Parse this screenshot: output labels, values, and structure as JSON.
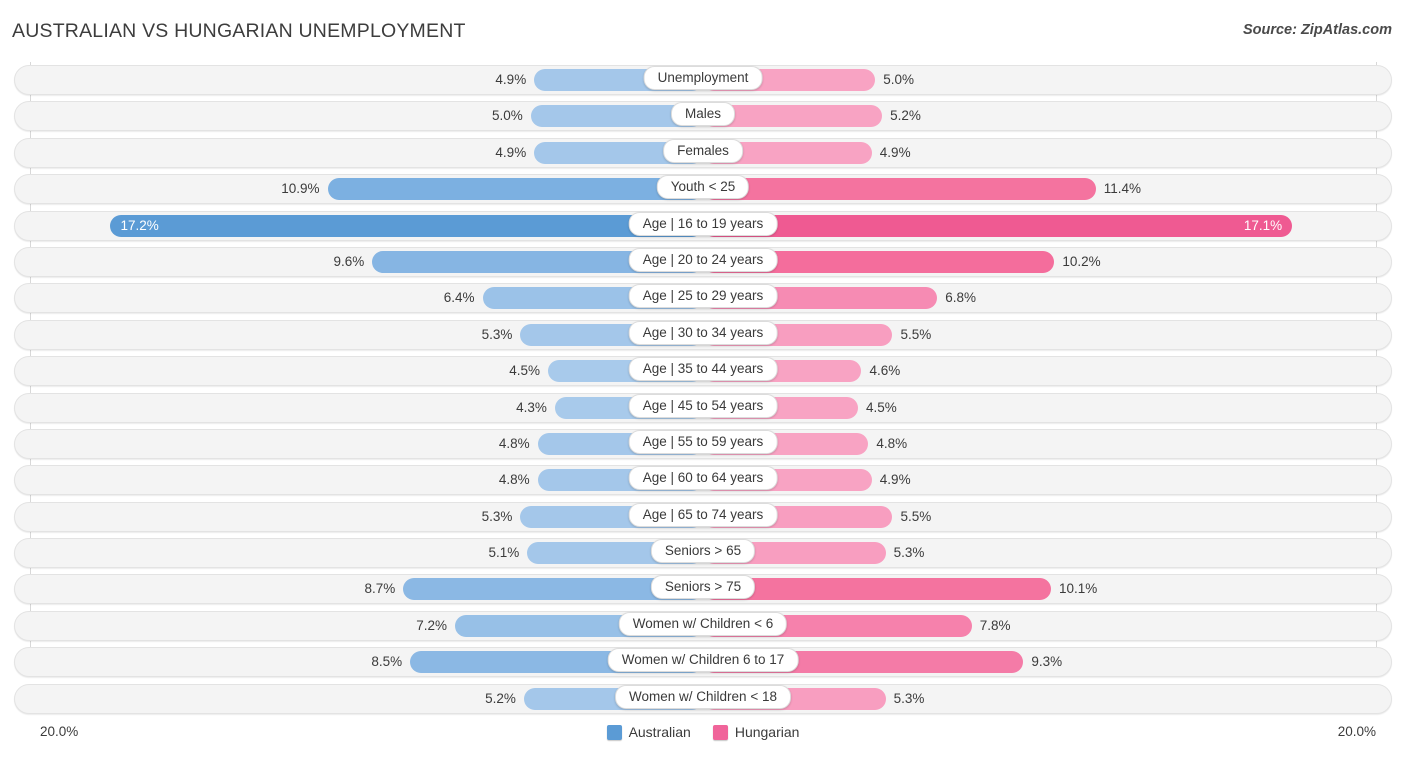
{
  "header": {
    "title": "AUSTRALIAN VS HUNGARIAN UNEMPLOYMENT",
    "source": "Source: ZipAtlas.com"
  },
  "footer": {
    "axis_left": "20.0%",
    "axis_right": "20.0%",
    "legend": [
      {
        "label": "Australian",
        "color": "#5b9bd5"
      },
      {
        "label": "Hungarian",
        "color": "#f0649a"
      }
    ]
  },
  "colors": {
    "australian_light": "#a4c7ea",
    "australian_mid": "#8bb8e4",
    "australian_dark": "#5b9bd5",
    "hungarian_light": "#f8a3c3",
    "hungarian_mid": "#f68bb3",
    "hungarian_dark": "#f0649a",
    "track_bg": "#f4f4f4",
    "track_border": "#e3e3e3"
  },
  "chart_data": {
    "type": "bar",
    "orientation": "diverging-horizontal",
    "title": "AUSTRALIAN VS HUNGARIAN UNEMPLOYMENT",
    "xlabel": "",
    "ylabel": "",
    "axis_max": 20.0,
    "axis_unit": "%",
    "grid": true,
    "legend_position": "bottom-center",
    "categories": [
      "Unemployment",
      "Males",
      "Females",
      "Youth < 25",
      "Age | 16 to 19 years",
      "Age | 20 to 24 years",
      "Age | 25 to 29 years",
      "Age | 30 to 34 years",
      "Age | 35 to 44 years",
      "Age | 45 to 54 years",
      "Age | 55 to 59 years",
      "Age | 60 to 64 years",
      "Age | 65 to 74 years",
      "Seniors > 65",
      "Seniors > 75",
      "Women w/ Children < 6",
      "Women w/ Children 6 to 17",
      "Women w/ Children < 18"
    ],
    "series": [
      {
        "name": "Australian",
        "side": "left",
        "color": "#5b9bd5",
        "values": [
          4.9,
          5.0,
          4.9,
          10.9,
          17.2,
          9.6,
          6.4,
          5.3,
          4.5,
          4.3,
          4.8,
          4.8,
          5.3,
          5.1,
          8.7,
          7.2,
          8.5,
          5.2
        ]
      },
      {
        "name": "Hungarian",
        "side": "right",
        "color": "#f0649a",
        "values": [
          5.0,
          5.2,
          4.9,
          11.4,
          17.1,
          10.2,
          6.8,
          5.5,
          4.6,
          4.5,
          4.8,
          4.9,
          5.5,
          5.3,
          10.1,
          7.8,
          9.3,
          5.3
        ]
      }
    ]
  },
  "rows": [
    {
      "label": "Unemployment",
      "left_value": "4.9%",
      "right_value": "5.0%",
      "left_num": 4.9,
      "right_num": 5.0,
      "left_color": "#a4c7ea",
      "right_color": "#f8a3c3",
      "left_inside": false,
      "right_inside": false
    },
    {
      "label": "Males",
      "left_value": "5.0%",
      "right_value": "5.2%",
      "left_num": 5.0,
      "right_num": 5.2,
      "left_color": "#a4c7ea",
      "right_color": "#f8a3c3",
      "left_inside": false,
      "right_inside": false
    },
    {
      "label": "Females",
      "left_value": "4.9%",
      "right_value": "4.9%",
      "left_num": 4.9,
      "right_num": 4.9,
      "left_color": "#a4c7ea",
      "right_color": "#f8a3c3",
      "left_inside": false,
      "right_inside": false
    },
    {
      "label": "Youth < 25",
      "left_value": "10.9%",
      "right_value": "11.4%",
      "left_num": 10.9,
      "right_num": 11.4,
      "left_color": "#7cb0e1",
      "right_color": "#f4739f",
      "left_inside": false,
      "right_inside": false
    },
    {
      "label": "Age | 16 to 19 years",
      "left_value": "17.2%",
      "right_value": "17.1%",
      "left_num": 17.2,
      "right_num": 17.1,
      "left_color": "#5b9bd5",
      "right_color": "#ef5a92",
      "left_inside": true,
      "right_inside": true
    },
    {
      "label": "Age | 20 to 24 years",
      "left_value": "9.6%",
      "right_value": "10.2%",
      "left_num": 9.6,
      "right_num": 10.2,
      "left_color": "#86b5e3",
      "right_color": "#f46d9c",
      "left_inside": false,
      "right_inside": false
    },
    {
      "label": "Age | 25 to 29 years",
      "left_value": "6.4%",
      "right_value": "6.8%",
      "left_num": 6.4,
      "right_num": 6.8,
      "left_color": "#9bc2e8",
      "right_color": "#f68bb3",
      "left_inside": false,
      "right_inside": false
    },
    {
      "label": "Age | 30 to 34 years",
      "left_value": "5.3%",
      "right_value": "5.5%",
      "left_num": 5.3,
      "right_num": 5.5,
      "left_color": "#a4c7ea",
      "right_color": "#f89ec0",
      "left_inside": false,
      "right_inside": false
    },
    {
      "label": "Age | 35 to 44 years",
      "left_value": "4.5%",
      "right_value": "4.6%",
      "left_num": 4.5,
      "right_num": 4.6,
      "left_color": "#a8caeb",
      "right_color": "#f8a3c3",
      "left_inside": false,
      "right_inside": false
    },
    {
      "label": "Age | 45 to 54 years",
      "left_value": "4.3%",
      "right_value": "4.5%",
      "left_num": 4.3,
      "right_num": 4.5,
      "left_color": "#a8caeb",
      "right_color": "#f8a3c3",
      "left_inside": false,
      "right_inside": false
    },
    {
      "label": "Age | 55 to 59 years",
      "left_value": "4.8%",
      "right_value": "4.8%",
      "left_num": 4.8,
      "right_num": 4.8,
      "left_color": "#a4c7ea",
      "right_color": "#f8a3c3",
      "left_inside": false,
      "right_inside": false
    },
    {
      "label": "Age | 60 to 64 years",
      "left_value": "4.8%",
      "right_value": "4.9%",
      "left_num": 4.8,
      "right_num": 4.9,
      "left_color": "#a4c7ea",
      "right_color": "#f8a3c3",
      "left_inside": false,
      "right_inside": false
    },
    {
      "label": "Age | 65 to 74 years",
      "left_value": "5.3%",
      "right_value": "5.5%",
      "left_num": 5.3,
      "right_num": 5.5,
      "left_color": "#a4c7ea",
      "right_color": "#f89ec0",
      "left_inside": false,
      "right_inside": false
    },
    {
      "label": "Seniors > 65",
      "left_value": "5.1%",
      "right_value": "5.3%",
      "left_num": 5.1,
      "right_num": 5.3,
      "left_color": "#a4c7ea",
      "right_color": "#f89ec0",
      "left_inside": false,
      "right_inside": false
    },
    {
      "label": "Seniors > 75",
      "left_value": "8.7%",
      "right_value": "10.1%",
      "left_num": 8.7,
      "right_num": 10.1,
      "left_color": "#8bb8e4",
      "right_color": "#f4739f",
      "left_inside": false,
      "right_inside": false
    },
    {
      "label": "Women w/ Children < 6",
      "left_value": "7.2%",
      "right_value": "7.8%",
      "left_num": 7.2,
      "right_num": 7.8,
      "left_color": "#97c0e7",
      "right_color": "#f681ac",
      "left_inside": false,
      "right_inside": false
    },
    {
      "label": "Women w/ Children 6 to 17",
      "left_value": "8.5%",
      "right_value": "9.3%",
      "left_num": 8.5,
      "right_num": 9.3,
      "left_color": "#8bb8e4",
      "right_color": "#f47ba7",
      "left_inside": false,
      "right_inside": false
    },
    {
      "label": "Women w/ Children < 18",
      "left_value": "5.2%",
      "right_value": "5.3%",
      "left_num": 5.2,
      "right_num": 5.3,
      "left_color": "#a4c7ea",
      "right_color": "#f89ec0",
      "left_inside": false,
      "right_inside": false
    }
  ]
}
